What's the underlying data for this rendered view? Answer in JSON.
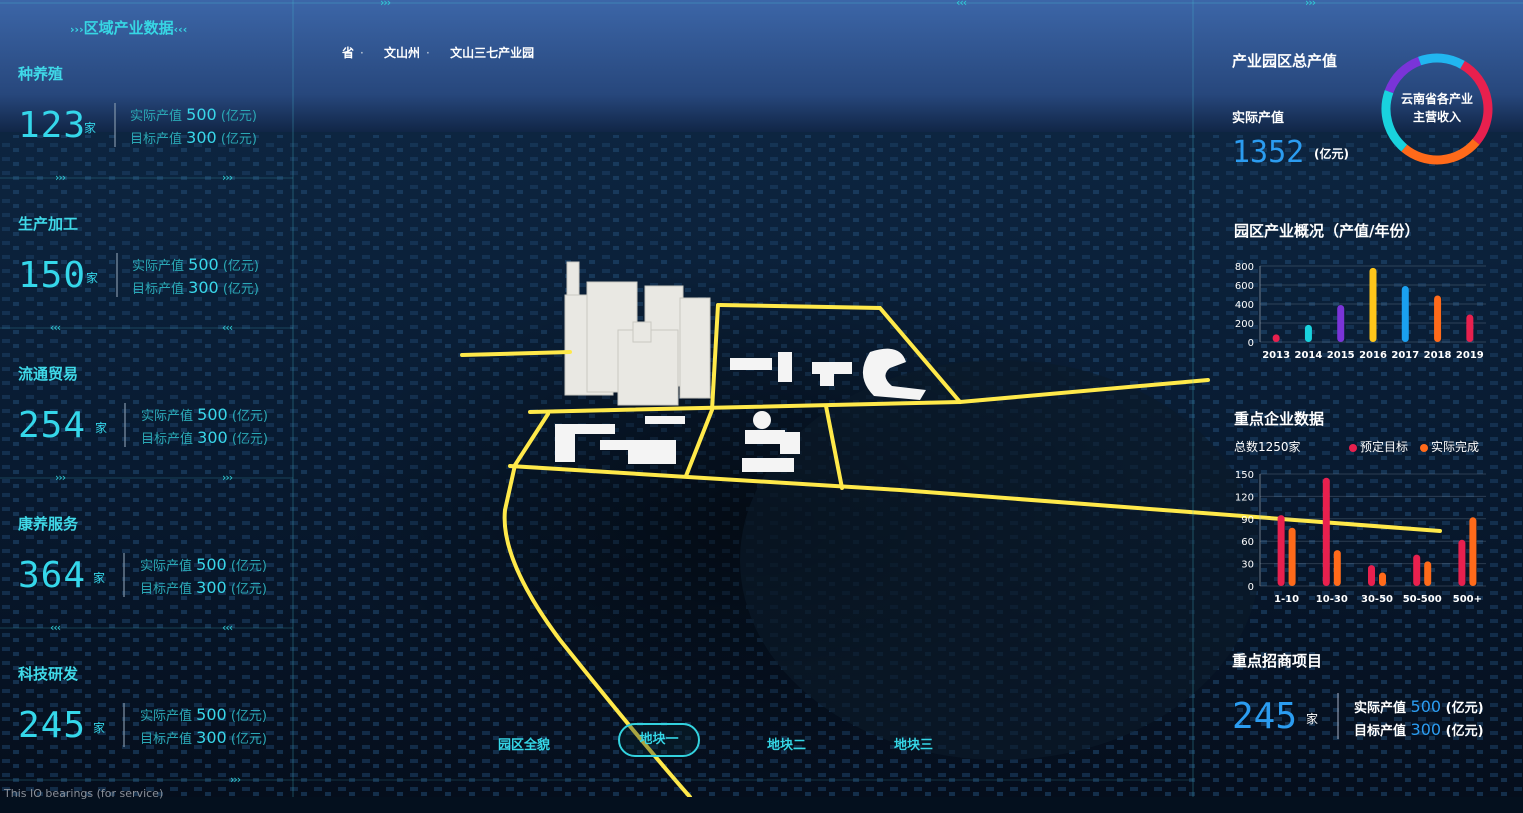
{
  "left_panel": {
    "title": "区域产业数据",
    "unit": "家",
    "actual_label": "实际产值",
    "target_label": "目标产值",
    "value_unit": "(亿元)",
    "categories": [
      {
        "name": "种养殖",
        "count": "123",
        "actual": "500",
        "target": "300"
      },
      {
        "name": "生产加工",
        "count": "150",
        "actual": "500",
        "target": "300"
      },
      {
        "name": "流通贸易",
        "count": "254",
        "actual": "500",
        "target": "300"
      },
      {
        "name": "康养服务",
        "count": "364",
        "actual": "500",
        "target": "300"
      },
      {
        "name": "科技研发",
        "count": "245",
        "actual": "500",
        "target": "300"
      }
    ]
  },
  "breadcrumb": [
    "省",
    "文山州",
    "文山三七产业园"
  ],
  "tabs": [
    "园区全貌",
    "地块一",
    "地块二",
    "地块三"
  ],
  "active_tab": "地块一",
  "footer_text": "This IO bearings (for service)",
  "right_panel": {
    "park_output": {
      "title": "产业园区总产值",
      "actual_label": "实际产值",
      "value": "1352",
      "unit": "(亿元)",
      "donut_label": "云南省各产业主营收入",
      "donut_colors": [
        "#e8204e",
        "#ff6a1a",
        "#19d2de",
        "#7a34d8",
        "#21b6f0"
      ]
    },
    "industry_overview": {
      "title": "园区产业概况（产值/年份）"
    },
    "key_enterprises": {
      "title": "重点企业数据",
      "total": "总数1250家",
      "legend": [
        {
          "label": "预定目标",
          "color": "#e8204e"
        },
        {
          "label": "实际完成",
          "color": "#ff6a1a"
        }
      ]
    },
    "investment": {
      "title": "重点招商项目",
      "count": "245",
      "unit": "家",
      "actual_label": "实际产值",
      "actual": "500",
      "target_label": "目标产值",
      "target": "300",
      "value_unit": "(亿元)"
    }
  },
  "chart_data": [
    {
      "type": "bar",
      "categories": [
        "2013",
        "2014",
        "2015",
        "2016",
        "2017",
        "2018",
        "2019"
      ],
      "values": [
        80,
        180,
        390,
        780,
        590,
        490,
        290
      ],
      "colors": [
        "#e8204e",
        "#19d2de",
        "#7a34d8",
        "#ffc61a",
        "#1aa0f0",
        "#ff6a1a",
        "#e8204e"
      ],
      "ylim": [
        0,
        800
      ],
      "yticks": [
        "0",
        "200",
        "400",
        "600",
        "800"
      ],
      "grid": true
    },
    {
      "type": "bar",
      "categories": [
        "1-10",
        "10-30",
        "30-50",
        "50-500",
        "500+"
      ],
      "series": [
        {
          "name": "预定目标",
          "values": [
            95,
            145,
            28,
            42,
            62
          ]
        },
        {
          "name": "实际完成",
          "values": [
            78,
            48,
            18,
            33,
            92
          ]
        }
      ],
      "ylim": [
        0,
        150
      ],
      "yticks": [
        "0",
        "30",
        "60",
        "90",
        "120",
        "150"
      ],
      "legend": "top-right",
      "grid": true
    }
  ]
}
